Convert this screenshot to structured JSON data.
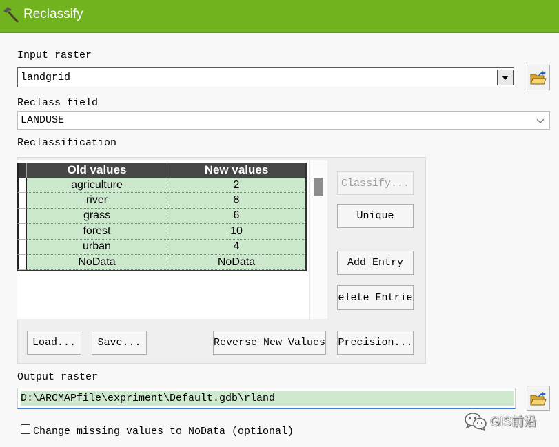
{
  "window": {
    "title": "Reclassify"
  },
  "input_raster": {
    "label": "Input raster",
    "value": "landgrid"
  },
  "reclass_field": {
    "label": "Reclass field",
    "value": "LANDUSE"
  },
  "reclassification": {
    "label": "Reclassification",
    "columns": {
      "old": "Old values",
      "new": "New values"
    },
    "rows": [
      {
        "old": "agriculture",
        "new": "2"
      },
      {
        "old": "river",
        "new": "8"
      },
      {
        "old": "grass",
        "new": "6"
      },
      {
        "old": "forest",
        "new": "10"
      },
      {
        "old": "urban",
        "new": "4"
      },
      {
        "old": "NoData",
        "new": "NoData"
      }
    ],
    "buttons": {
      "classify": "Classify...",
      "unique": "Unique",
      "add_entry": "Add Entry",
      "delete_entries": "elete Entrie",
      "load": "Load...",
      "save": "Save...",
      "reverse": "Reverse New Values",
      "precision": "Precision..."
    },
    "states": {
      "classify_disabled": true
    }
  },
  "output_raster": {
    "label": "Output raster",
    "value": "D:\\ARCMAPfile\\expriment\\Default.gdb\\rland"
  },
  "missing_to_nodata": {
    "label": "Change missing values to NoData (optional)",
    "checked": false
  },
  "watermark": {
    "text": "GIS前沿"
  },
  "icons": {
    "title": "hammer-icon",
    "browse": "folder-open-icon",
    "dropdown": "triangle-down-icon",
    "field_dropdown": "chevron-down-icon",
    "watermark": "wechat-icon"
  },
  "colors": {
    "title_bar": "#70b31f",
    "row_fill": "#cce8cc",
    "header_fill": "#474747",
    "focus_line": "#3a7bd5",
    "selection": "#cfe9cf"
  }
}
